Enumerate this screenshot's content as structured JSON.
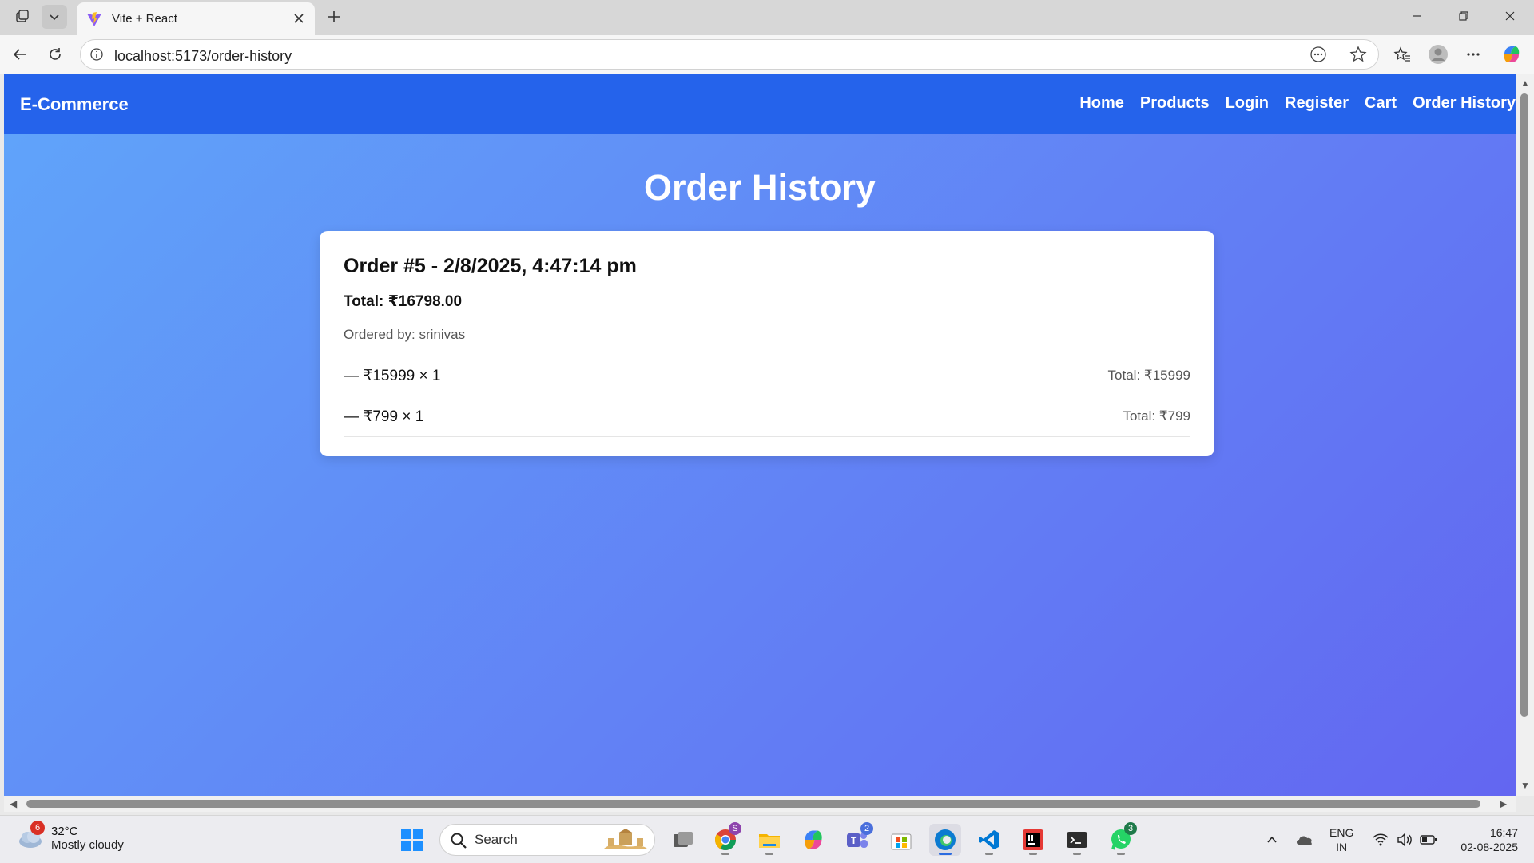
{
  "browser": {
    "tab_title": "Vite + React",
    "url": "localhost:5173/order-history"
  },
  "navbar": {
    "brand": "E-Commerce",
    "links": [
      "Home",
      "Products",
      "Login",
      "Register",
      "Cart",
      "Order History"
    ]
  },
  "page": {
    "title": "Order History",
    "order": {
      "title": "Order #5 - 2/8/2025, 4:47:14 pm",
      "total": "Total: ₹16798.00",
      "ordered_by": "Ordered by: srinivas",
      "items": [
        {
          "left": "— ₹15999 × 1",
          "right": "Total: ₹15999"
        },
        {
          "left": "— ₹799 × 1",
          "right": "Total: ₹799"
        }
      ]
    }
  },
  "taskbar": {
    "weather_temp": "32°C",
    "weather_desc": "Mostly cloudy",
    "weather_badge": "6",
    "search_label": "Search",
    "chrome_badge": "S",
    "teams_badge": "2",
    "whatsapp_badge": "3",
    "lang_1": "ENG",
    "lang_2": "IN",
    "time": "16:47",
    "date": "02-08-2025"
  },
  "colors": {
    "navbar": "#2563eb",
    "gradient_start": "#60a5fa",
    "gradient_end": "#6366f1"
  }
}
